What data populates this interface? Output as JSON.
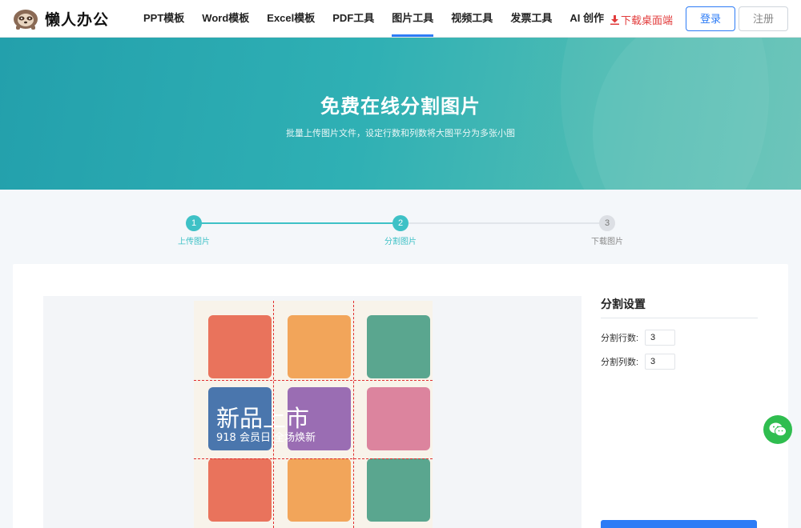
{
  "header": {
    "logo_text": "懒人办公",
    "nav": [
      {
        "label": "PPT模板"
      },
      {
        "label": "Word模板"
      },
      {
        "label": "Excel模板"
      },
      {
        "label": "PDF工具"
      },
      {
        "label": "图片工具",
        "active": true
      },
      {
        "label": "视频工具"
      },
      {
        "label": "发票工具"
      },
      {
        "label": "AI 创作"
      }
    ],
    "download_label": "下载桌面端",
    "login_label": "登录",
    "register_label": "注册"
  },
  "banner": {
    "title": "免费在线分割图片",
    "subtitle": "批量上传图片文件，设定行数和列数将大图平分为多张小图"
  },
  "steps": [
    {
      "number": "1",
      "label": "上传图片",
      "state": "done"
    },
    {
      "number": "2",
      "label": "分割图片",
      "state": "current"
    },
    {
      "number": "3",
      "label": "下载图片",
      "state": "todo"
    }
  ],
  "preview": {
    "promo_title": "新品上市",
    "promo_subtitle": "918 会员日 全场焕新",
    "rows": 3,
    "cols": 3,
    "tile_colors": [
      "#e9735c",
      "#f2a55a",
      "#5aa68f",
      "#4a76ad",
      "#9a6db3",
      "#dc849e",
      "#e9735c",
      "#f2a55a",
      "#5aa68f"
    ]
  },
  "settings": {
    "title": "分割设置",
    "rows_label": "分割行数:",
    "rows_value": "3",
    "cols_label": "分割列数:",
    "cols_value": "3"
  },
  "colors": {
    "accent": "#2d7cf6",
    "teal": "#3ec1c6",
    "download_red": "#e23b3b",
    "wechat_green": "#2fbd4f"
  }
}
